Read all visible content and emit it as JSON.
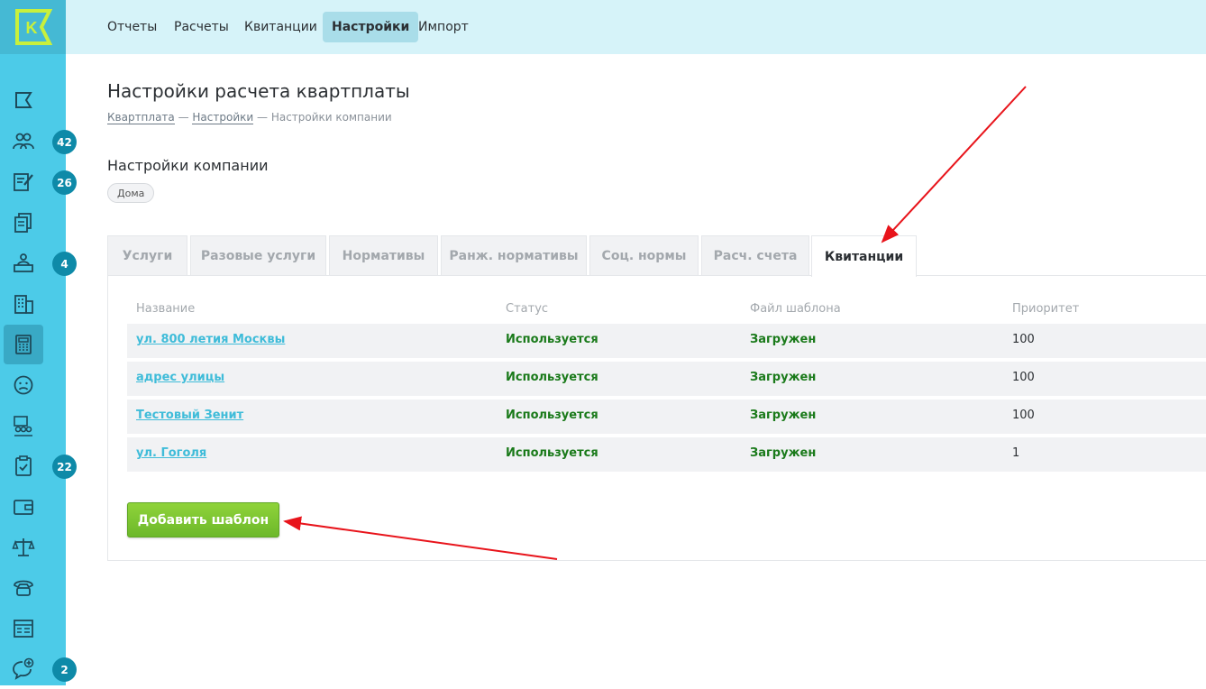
{
  "logo": {
    "letter": "K"
  },
  "topnav": [
    {
      "label": "Отчеты"
    },
    {
      "label": "Расчеты"
    },
    {
      "label": "Квитанции"
    },
    {
      "label": "Настройки",
      "active": true
    },
    {
      "label": "Импорт"
    }
  ],
  "sidebar": {
    "badges": [
      "42",
      "26",
      "4",
      "22",
      "2"
    ]
  },
  "page": {
    "title": "Настройки расчета квартплаты",
    "breadcrumb": [
      "Квартплата",
      "Настройки",
      "Настройки компании"
    ],
    "breadcrumb_sep": " — ",
    "section_title": "Настройки компании",
    "chip": "Дома"
  },
  "tabs": [
    {
      "label": "Услуги"
    },
    {
      "label": "Разовые услуги"
    },
    {
      "label": "Нормативы"
    },
    {
      "label": "Ранж. нормативы"
    },
    {
      "label": "Соц. нормы"
    },
    {
      "label": "Расч. счета"
    },
    {
      "label": "Квитанции",
      "active": true
    }
  ],
  "table": {
    "headers": [
      "Название",
      "Статус",
      "Файл шаблона",
      "Приоритет"
    ],
    "rows": [
      {
        "name": "ул. 800 летия Москвы",
        "status": "Используется",
        "file": "Загружен",
        "priority": "100"
      },
      {
        "name": "адрес улицы",
        "status": "Используется",
        "file": "Загружен",
        "priority": "100"
      },
      {
        "name": "Тестовый Зенит",
        "status": "Используется",
        "file": "Загружен",
        "priority": "100"
      },
      {
        "name": "ул. Гоголя",
        "status": "Используется",
        "file": "Загружен",
        "priority": "1"
      }
    ]
  },
  "actions": {
    "add_template": "Добавить шаблон"
  },
  "colors": {
    "sidebar": "#4ccbe8",
    "accent": "#3fbcd9",
    "button": "#7cc732",
    "annotation": "#e8141b"
  }
}
